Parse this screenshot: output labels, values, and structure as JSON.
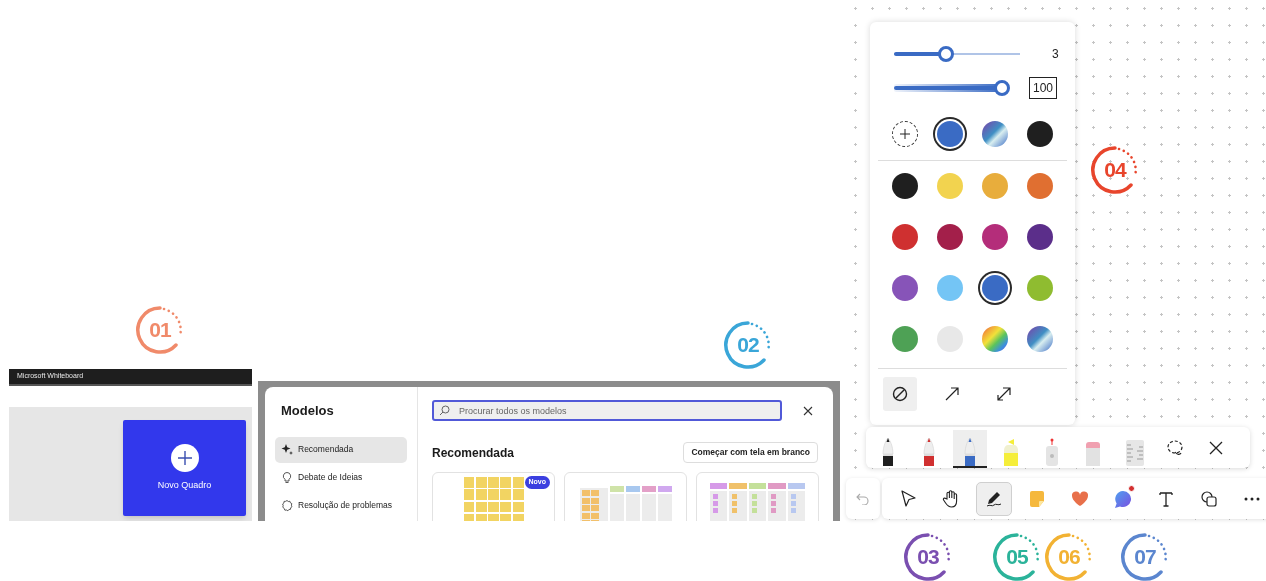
{
  "badges": [
    {
      "number": "01",
      "color": "#f08a6a"
    },
    {
      "number": "02",
      "color": "#3aa6d8"
    },
    {
      "number": "03",
      "color": "#7a4fb0"
    },
    {
      "number": "04",
      "color": "#e8452c"
    },
    {
      "number": "05",
      "color": "#2bb39a"
    },
    {
      "number": "06",
      "color": "#f2b233"
    },
    {
      "number": "07",
      "color": "#5b86cf"
    }
  ],
  "whiteboard_app": {
    "title": "Microsoft Whiteboard",
    "new_board_button": "Novo Quadro"
  },
  "templates_dialog": {
    "title": "Modelos",
    "categories": [
      {
        "kind": "sparkle",
        "label": "Recomendada",
        "selected": true
      },
      {
        "kind": "bulb",
        "label": "Debate de Ideias",
        "selected": false
      },
      {
        "kind": "gear",
        "label": "Resolução de problemas",
        "selected": false
      }
    ],
    "search": {
      "placeholder": "Procurar todos os modelos"
    },
    "section_title": "Recomendada",
    "blank_button": "Começar com tela em branco",
    "templates": [
      {
        "kind": "sticky-grid",
        "badge": "Novo"
      },
      {
        "kind": "table"
      },
      {
        "kind": "kanban"
      }
    ]
  },
  "pen_panel": {
    "thickness": {
      "level": 0.41,
      "reading": "3"
    },
    "opacity": {
      "level": 1,
      "value": "100"
    },
    "recent_colors": [
      {
        "kind": "add",
        "selected": false
      },
      {
        "kind": "solid",
        "color": "#3a6bc4",
        "selected": true
      },
      {
        "kind": "galaxy",
        "selected": false
      },
      {
        "kind": "solid",
        "color": "#1f1f1f",
        "selected": false
      }
    ],
    "palette": [
      {
        "kind": "solid",
        "color": "#1f1f1f",
        "selected": false
      },
      {
        "kind": "solid",
        "color": "#f2d34f",
        "selected": false
      },
      {
        "kind": "solid",
        "color": "#e8ad3c",
        "selected": false
      },
      {
        "kind": "solid",
        "color": "#e06f31",
        "selected": false
      },
      {
        "kind": "solid",
        "color": "#cf3030",
        "selected": false
      },
      {
        "kind": "solid",
        "color": "#a31f4a",
        "selected": false
      },
      {
        "kind": "solid",
        "color": "#b42d7a",
        "selected": false
      },
      {
        "kind": "solid",
        "color": "#5b2e8a",
        "selected": false
      },
      {
        "kind": "solid",
        "color": "#8754b8",
        "selected": false
      },
      {
        "kind": "solid",
        "color": "#74c5f5",
        "selected": false
      },
      {
        "kind": "solid",
        "color": "#3a6bc4",
        "selected": true
      },
      {
        "kind": "solid",
        "color": "#8fbc30",
        "selected": false
      },
      {
        "kind": "solid",
        "color": "#4ea155",
        "selected": false
      },
      {
        "kind": "solid",
        "color": "#e8e8e8",
        "selected": false
      },
      {
        "kind": "rainbow",
        "selected": false
      },
      {
        "kind": "galaxy",
        "selected": false
      }
    ],
    "end_styles": [
      {
        "kind": "none",
        "selected": true
      },
      {
        "kind": "arrow",
        "selected": false
      },
      {
        "kind": "double-arrow",
        "selected": false
      }
    ]
  },
  "pen_tray": [
    {
      "kind": "pen",
      "color": "#1f1f1f",
      "selected": false
    },
    {
      "kind": "pen",
      "color": "#d03030",
      "selected": false
    },
    {
      "kind": "pen",
      "color": "#3a6bc4",
      "selected": true
    },
    {
      "kind": "highlighter",
      "color": "#f5ee3a",
      "selected": false
    },
    {
      "kind": "laser",
      "selected": false
    },
    {
      "kind": "eraser",
      "selected": false
    },
    {
      "kind": "ruler",
      "selected": false
    },
    {
      "kind": "lasso",
      "selected": false
    },
    {
      "kind": "close",
      "selected": false
    }
  ],
  "undo_button": {
    "disabled": true
  },
  "toolbar": [
    {
      "kind": "select",
      "selected": false,
      "notification": false
    },
    {
      "kind": "hand",
      "selected": false,
      "notification": false
    },
    {
      "kind": "ink",
      "selected": true,
      "notification": false
    },
    {
      "kind": "sticky",
      "selected": false,
      "notification": false
    },
    {
      "kind": "heart",
      "selected": false,
      "notification": false
    },
    {
      "kind": "comment",
      "selected": false,
      "notification": true
    },
    {
      "kind": "text",
      "selected": false,
      "notification": false
    },
    {
      "kind": "shapes",
      "selected": false,
      "notification": false
    },
    {
      "kind": "more",
      "selected": false,
      "notification": false
    }
  ]
}
